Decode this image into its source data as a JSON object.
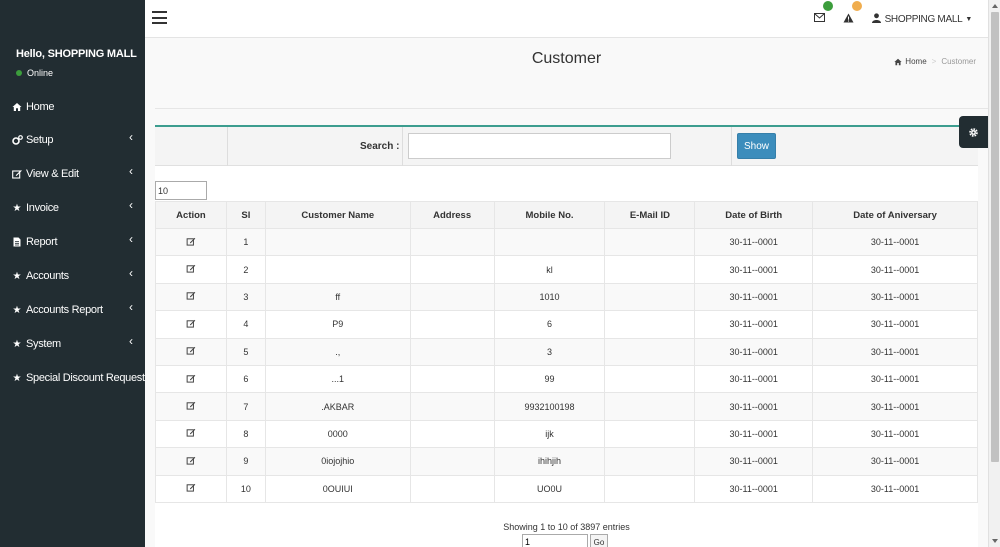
{
  "user_panel": {
    "greeting": "Hello, SHOPPING MALL",
    "status": "Online"
  },
  "sidebar": {
    "items": [
      {
        "label": "Home",
        "icon": "home-icon",
        "has_submenu": false
      },
      {
        "label": "Setup",
        "icon": "cogs-icon",
        "has_submenu": true
      },
      {
        "label": "View & Edit",
        "icon": "edit-icon",
        "has_submenu": true
      },
      {
        "label": "Invoice",
        "icon": "star-icon",
        "has_submenu": true
      },
      {
        "label": "Report",
        "icon": "file-icon",
        "has_submenu": true
      },
      {
        "label": "Accounts",
        "icon": "star-icon",
        "has_submenu": true
      },
      {
        "label": "Accounts Report",
        "icon": "star-icon",
        "has_submenu": true
      },
      {
        "label": "System",
        "icon": "star-icon",
        "has_submenu": true
      },
      {
        "label": "Special Discount Request",
        "icon": "star-icon",
        "has_submenu": false
      }
    ]
  },
  "topbar": {
    "user_label": "SHOPPING MALL",
    "badge_colors": {
      "messages": "#3c9d3c",
      "alerts": "#f0ad4e"
    }
  },
  "page": {
    "title": "Customer",
    "breadcrumb": {
      "home": "Home",
      "current": "Customer"
    }
  },
  "search": {
    "label": "Search :",
    "value": "",
    "button_label": "Show"
  },
  "table": {
    "page_length": "10",
    "columns": [
      "Action",
      "Sl",
      "Customer Name",
      "Address",
      "Mobile No.",
      "E-Mail ID",
      "Date of Birth",
      "Date of Aniversary"
    ],
    "rows": [
      {
        "sl": "1",
        "name": "",
        "address": "",
        "mobile": "",
        "email": "",
        "dob": "30-11--0001",
        "doa": "30-11--0001"
      },
      {
        "sl": "2",
        "name": "",
        "address": "",
        "mobile": "kl",
        "email": "",
        "dob": "30-11--0001",
        "doa": "30-11--0001"
      },
      {
        "sl": "3",
        "name": "ff",
        "address": "",
        "mobile": "1010",
        "email": "",
        "dob": "30-11--0001",
        "doa": "30-11--0001"
      },
      {
        "sl": "4",
        "name": "P9",
        "address": "",
        "mobile": "6",
        "email": "",
        "dob": "30-11--0001",
        "doa": "30-11--0001"
      },
      {
        "sl": "5",
        "name": ".,",
        "address": "",
        "mobile": "3",
        "email": "",
        "dob": "30-11--0001",
        "doa": "30-11--0001"
      },
      {
        "sl": "6",
        "name": "...1",
        "address": "",
        "mobile": "99",
        "email": "",
        "dob": "30-11--0001",
        "doa": "30-11--0001"
      },
      {
        "sl": "7",
        "name": ".AKBAR",
        "address": "",
        "mobile": "9932100198",
        "email": "",
        "dob": "30-11--0001",
        "doa": "30-11--0001"
      },
      {
        "sl": "8",
        "name": "0000",
        "address": "",
        "mobile": "ijk",
        "email": "",
        "dob": "30-11--0001",
        "doa": "30-11--0001"
      },
      {
        "sl": "9",
        "name": "0iojojhio",
        "address": "",
        "mobile": "ihihjih",
        "email": "",
        "dob": "30-11--0001",
        "doa": "30-11--0001"
      },
      {
        "sl": "10",
        "name": "0OUIUI",
        "address": "",
        "mobile": "UO0U",
        "email": "",
        "dob": "30-11--0001",
        "doa": "30-11--0001"
      }
    ]
  },
  "pagination": {
    "info": "Showing 1 to 10 of 3897 entries",
    "page_value": "1",
    "go_label": "Go"
  }
}
